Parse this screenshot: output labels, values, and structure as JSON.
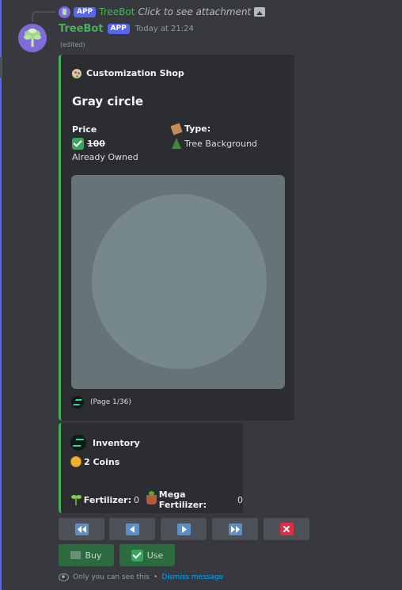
{
  "reply": {
    "badge": "APP",
    "name": "TreeBot",
    "text": "Click to see attachment"
  },
  "message": {
    "author": "TreeBot",
    "badge": "APP",
    "timestamp": "Today at 21:24",
    "edited": "(edited)"
  },
  "shop_embed": {
    "author": "Customization Shop",
    "title": "Gray circle",
    "price_label": "Price",
    "price_value": "100",
    "price_status": "Already Owned",
    "type_label": "Type:",
    "type_value": "Tree Background",
    "footer": "(Page 1/36)",
    "preview_colors": {
      "background": "#667478",
      "circle": "#76888d"
    }
  },
  "inventory_embed": {
    "author": "Inventory",
    "coins": "2 Coins",
    "fertilizer_label": "Fertilizer:",
    "fertilizer_value": "0",
    "mega_label": "Mega Fertilizer:",
    "mega_value": "0"
  },
  "buttons": {
    "first": "first-page",
    "prev": "previous-page",
    "next": "next-page",
    "last": "last-page",
    "close": "close",
    "buy": "Buy",
    "use": "Use"
  },
  "ephemeral": {
    "text": "Only you can see this",
    "separator": "•",
    "dismiss": "Dismiss message"
  },
  "colors": {
    "accent": "#43b05c",
    "author": "#4dae5e",
    "link": "#00a8fc",
    "app_badge": "#5865f2"
  }
}
